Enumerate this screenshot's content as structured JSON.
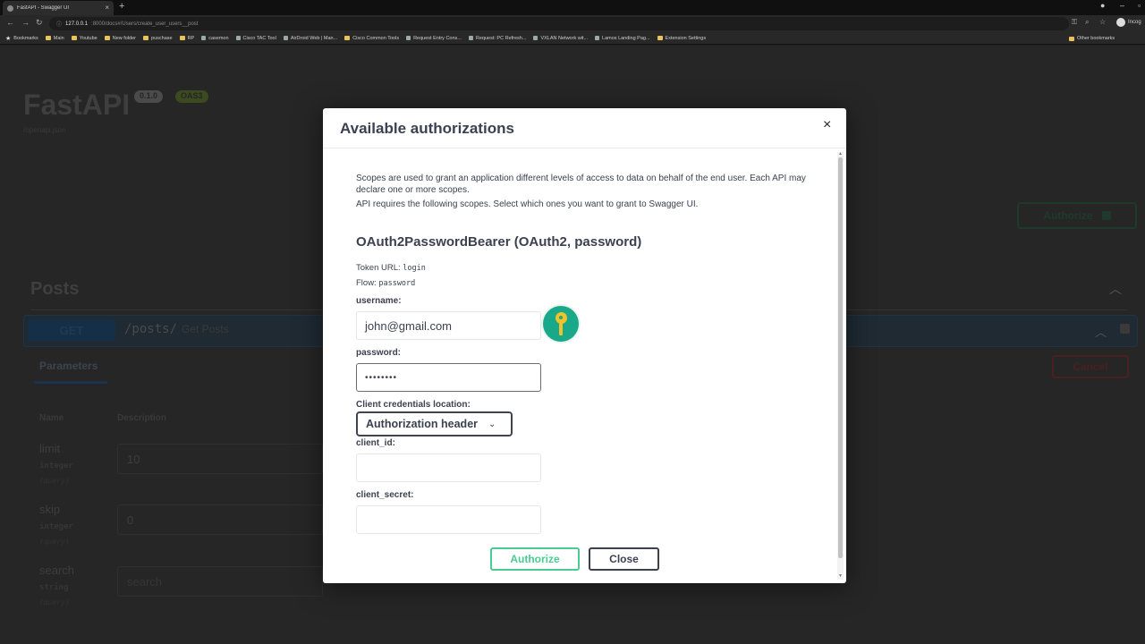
{
  "browser": {
    "tab_title": "FastAPI - Swagger UI",
    "url_host": "127.0.0.1",
    "url_path": ":8000/docs#/Users/create_user_users__post",
    "profile_label": "Incog",
    "bookmarks": [
      {
        "label": "Bookmarks",
        "icon": "star"
      },
      {
        "label": "Main",
        "icon": "folder"
      },
      {
        "label": "Youtube",
        "icon": "folder"
      },
      {
        "label": "New folder",
        "icon": "folder"
      },
      {
        "label": "puschase",
        "icon": "folder"
      },
      {
        "label": "RP",
        "icon": "folder"
      },
      {
        "label": "casemon",
        "icon": "page"
      },
      {
        "label": "Cisco TAC Tool",
        "icon": "page"
      },
      {
        "label": "AirDroid Web | Man...",
        "icon": "page"
      },
      {
        "label": "Cisco Common Tools",
        "icon": "folder"
      },
      {
        "label": "Request Entry Cons...",
        "icon": "page"
      },
      {
        "label": "Request: PC Refresh...",
        "icon": "page"
      },
      {
        "label": "VXLAN Network wit...",
        "icon": "page"
      },
      {
        "label": "Lamos Landing Pag...",
        "icon": "page"
      },
      {
        "label": "Extension Settings",
        "icon": "folder"
      }
    ],
    "other_bookmarks": "Other bookmarks"
  },
  "background": {
    "app_title": "FastAPI",
    "version_badge": "0.1.0",
    "oas_badge": "OAS3",
    "openapi_link": "/openapi.json",
    "authorize_label": "Authorize",
    "section_title": "Posts",
    "operation": {
      "method": "GET",
      "path": "/posts/",
      "summary": "Get Posts"
    },
    "parameters_tab": "Parameters",
    "cancel_label": "Cancel",
    "col_name": "Name",
    "col_description": "Description",
    "params": [
      {
        "name": "limit",
        "type": "integer",
        "in": "(query)",
        "value": "10"
      },
      {
        "name": "skip",
        "type": "integer",
        "in": "(query)",
        "value": "0"
      },
      {
        "name": "search",
        "type": "string",
        "in": "(query)",
        "placeholder": "search"
      }
    ]
  },
  "modal": {
    "title": "Available authorizations",
    "close_glyph": "×",
    "scopes_desc_1": "Scopes are used to grant an application different levels of access to data on behalf of the end user. Each API may declare one or more scopes.",
    "scopes_desc_2": "API requires the following scopes. Select which ones you want to grant to Swagger UI.",
    "scheme_title": "OAuth2PasswordBearer (OAuth2, password)",
    "token_url_label": "Token URL:",
    "token_url_value": "login",
    "flow_label": "Flow:",
    "flow_value": "password",
    "username_label": "username:",
    "username_value": "john@gmail.com",
    "password_label": "password:",
    "password_value": "••••••••",
    "client_loc_label": "Client credentials location:",
    "client_loc_value": "Authorization header",
    "client_id_label": "client_id:",
    "client_id_value": "",
    "client_secret_label": "client_secret:",
    "client_secret_value": "",
    "authorize_label": "Authorize",
    "close_label": "Close"
  },
  "colors": {
    "accent_green": "#49cc90",
    "text": "#3b4151",
    "key_icon_bg": "#1aa88a",
    "key_icon_fg": "#f3c228"
  }
}
